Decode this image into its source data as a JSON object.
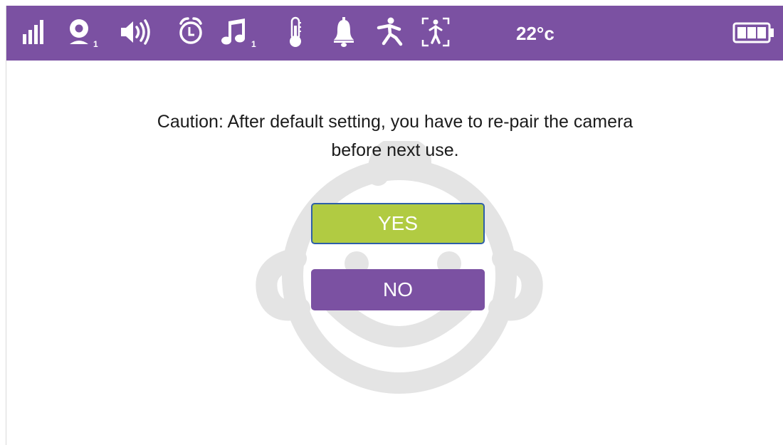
{
  "status_bar": {
    "icons": [
      "signal-strength-icon",
      "camera-icon",
      "speaker-volume-icon",
      "alarm-clock-icon",
      "music-note-icon",
      "thermometer-icon",
      "bell-icon",
      "motion-icon",
      "person-detection-icon",
      "battery-icon"
    ],
    "camera_number": "1",
    "music_number": "1",
    "temperature": "22°c",
    "background_color": "#7b51a2"
  },
  "dialog": {
    "message_line1": "Caution: After default setting, you have to re-pair the camera",
    "message_line2": "before next use.",
    "yes_label": "YES",
    "no_label": "NO",
    "yes_color": "#b1cb42",
    "no_color": "#7b51a2"
  },
  "background_watermark": "baby-face-icon"
}
